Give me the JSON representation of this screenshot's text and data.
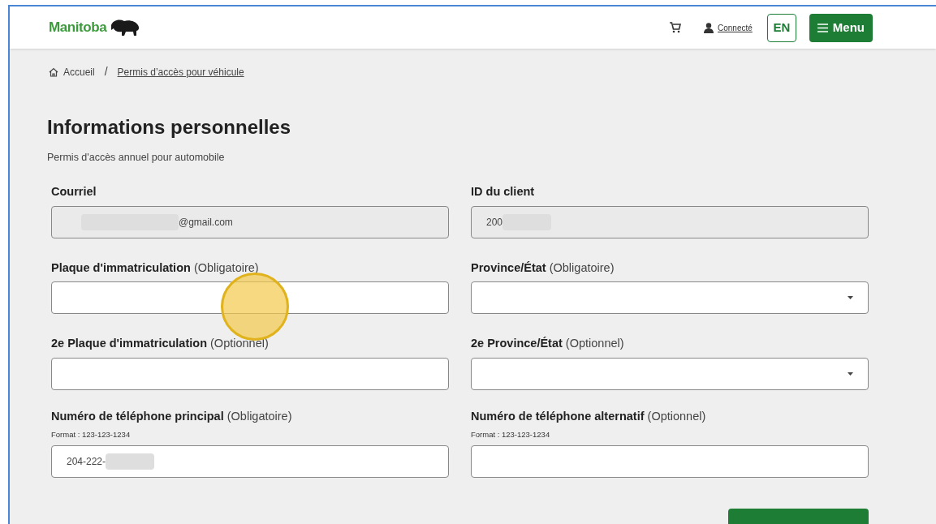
{
  "header": {
    "logo_text": "Manitoba",
    "account_link": "Connecté",
    "language_button": "EN",
    "menu_button": "Menu"
  },
  "breadcrumb": [
    {
      "label": "Accueil",
      "kind": "home"
    },
    {
      "label": "Permis d’accès pour véhicule",
      "kind": "link"
    }
  ],
  "breadcrumb_separator": "/",
  "heading": "Informations personnelles",
  "subheading": "Permis d'accès annuel pour automobile",
  "fields": [
    {
      "kind": "text",
      "label": "Courriel",
      "disabled": true,
      "value": "@gmail.com",
      "blurred_before": true
    },
    {
      "kind": "text",
      "label": "ID du client",
      "disabled": true,
      "value": "200",
      "blurred_after": true
    },
    {
      "kind": "text",
      "label": "Plaque d'immatriculation",
      "qualifier": "(Obligatoire)",
      "disabled": false
    },
    {
      "kind": "select",
      "label": "Province/État",
      "qualifier": "(Obligatoire)",
      "disabled": false
    },
    {
      "kind": "text",
      "label": "2e Plaque d'immatriculation",
      "qualifier": "(Optionnel)",
      "disabled": false
    },
    {
      "kind": "select",
      "label": "2e Province/État",
      "qualifier": "(Optionnel)",
      "disabled": false
    },
    {
      "kind": "text",
      "label": "Numéro de téléphone principal",
      "qualifier": "(Obligatoire)",
      "hint": "Format : 123-123-1234",
      "disabled": false,
      "value": "204-222-",
      "blurred_after": true
    },
    {
      "kind": "text",
      "label": "Numéro de téléphone alternatif",
      "qualifier": "(Optionnel)",
      "hint": "Format : 123-123-1234",
      "disabled": false
    }
  ]
}
